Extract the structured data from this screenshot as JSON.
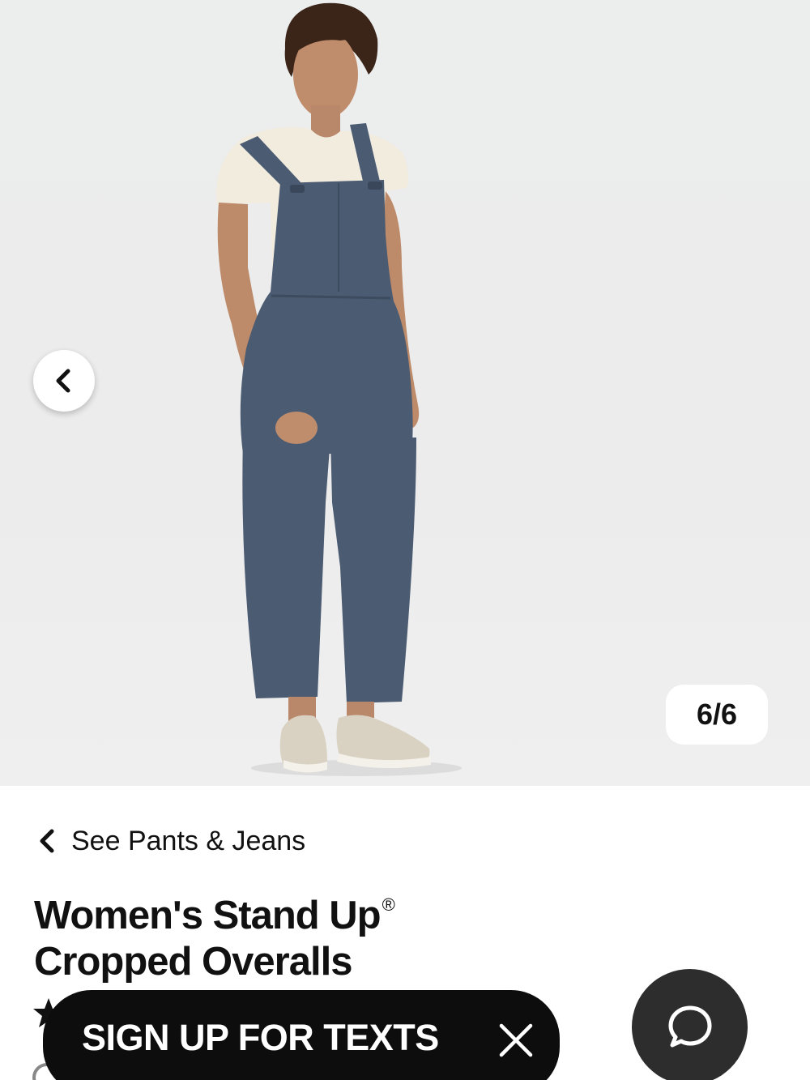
{
  "gallery": {
    "image_alt": "Model wearing the overalls",
    "counter": "6/6"
  },
  "breadcrumb": {
    "label": "See Pants & Jeans"
  },
  "product": {
    "title_line1": "Women's Stand Up",
    "registered_mark": "®",
    "title_line2": "Cropped Overalls"
  },
  "sms_banner": {
    "label": "SIGN UP FOR TEXTS"
  },
  "colors": {
    "gallery_bg": "#ececec",
    "overalls": "#4b5b72",
    "banner_bg": "#0d0d0d",
    "chat_bg": "#2d2d2d"
  },
  "icons": {
    "prev": "chevron-left-icon",
    "back": "chevron-left-icon",
    "close": "close-icon",
    "chat": "chat-bubble-icon",
    "rating": "star-icon"
  }
}
